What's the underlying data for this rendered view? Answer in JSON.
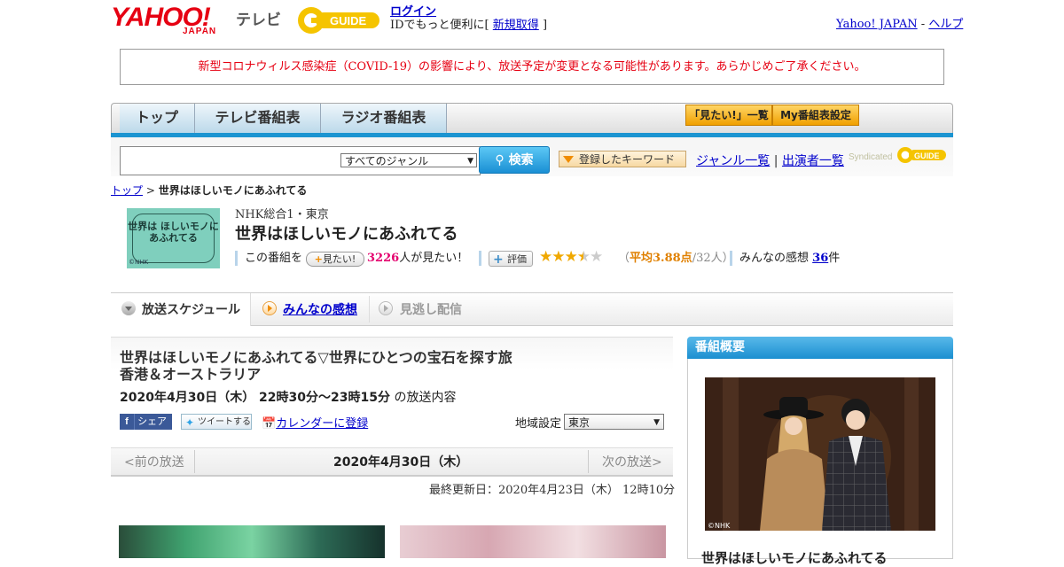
{
  "header": {
    "yahoo_logo": "YAHOO!",
    "yahoo_sub": "JAPAN",
    "tv_label": "テレビ",
    "gguide_logo": "GUIDE",
    "login_link": "ログイン",
    "id_text": "IDでもっと便利に[",
    "signup_link": "新規取得",
    "id_close": "]",
    "yahoo_japan_link": "Yahoo! JAPAN",
    "sep": "-",
    "help_link": "ヘルプ"
  },
  "notice": "新型コロナウィルス感染症（COVID-19）の影響により、放送予定が変更となる可能性があります。あらかじめご了承ください。",
  "nav": {
    "tabs": [
      "トップ",
      "テレビ番組表",
      "ラジオ番組表"
    ],
    "mitai_list": "「見たい!」一覧",
    "my_settings": "My番組表設定"
  },
  "search": {
    "genre_selected": "すべてのジャンル",
    "button": "検索",
    "keyword_button": "登録したキーワード",
    "genre_list": "ジャンル一覧",
    "divider": "|",
    "performer_list": "出演者一覧",
    "syndicated": "Syndicated",
    "syndicated_logo": "GUIDE"
  },
  "breadcrumb": {
    "top": "トップ",
    "sep": ">",
    "current": "世界はほしいモノにあふれてる"
  },
  "program": {
    "thumb_text": "世界は ほしいモノに あふれてる",
    "thumb_credit": "©NHK",
    "channel": "NHK総合1・東京",
    "title": "世界はほしいモノにあふれてる",
    "this_program": "この番組を",
    "mitai_button": "見たい!",
    "mitai_count": "3226",
    "mitai_suffix": "人が見たい！",
    "rating_button": "評価",
    "stars": "★★★★★",
    "avg_open": "（",
    "avg_label": "平均3.88点",
    "avg_votes": "/32人）",
    "reviews_label": "みんなの感想",
    "reviews_count": "36",
    "reviews_suffix": "件"
  },
  "tabs": {
    "schedule": "放送スケジュール",
    "reviews": "みんなの感想",
    "catchup": "見逃し配信"
  },
  "episode": {
    "title": "世界はほしいモノにあふれてる▽世界にひとつの宝石を探す旅　香港＆オーストラリア",
    "date": "2020年4月30日（木）  22時30分～23時15分",
    "date_suffix": " の放送内容",
    "share": "シェア",
    "tweet": "ツイートする",
    "calendar": "カレンダーに登録",
    "region_label": "地域設定",
    "region_value": "東京"
  },
  "pager": {
    "prev": "<前の放送",
    "current": "2020年4月30日（木）",
    "next": "次の放送>"
  },
  "updated": "最終更新日：2020年4月23日（木）  12時10分",
  "sidebar": {
    "header": "番組概要",
    "photo_credit": "©NHK",
    "caption": "世界はほしいモノにあふれてる"
  },
  "colors": {
    "yahoo_red": "#e60012",
    "nav_blue": "#1b94d1",
    "mitai_pink": "#e4006e",
    "rating_orange": "#e08000"
  }
}
